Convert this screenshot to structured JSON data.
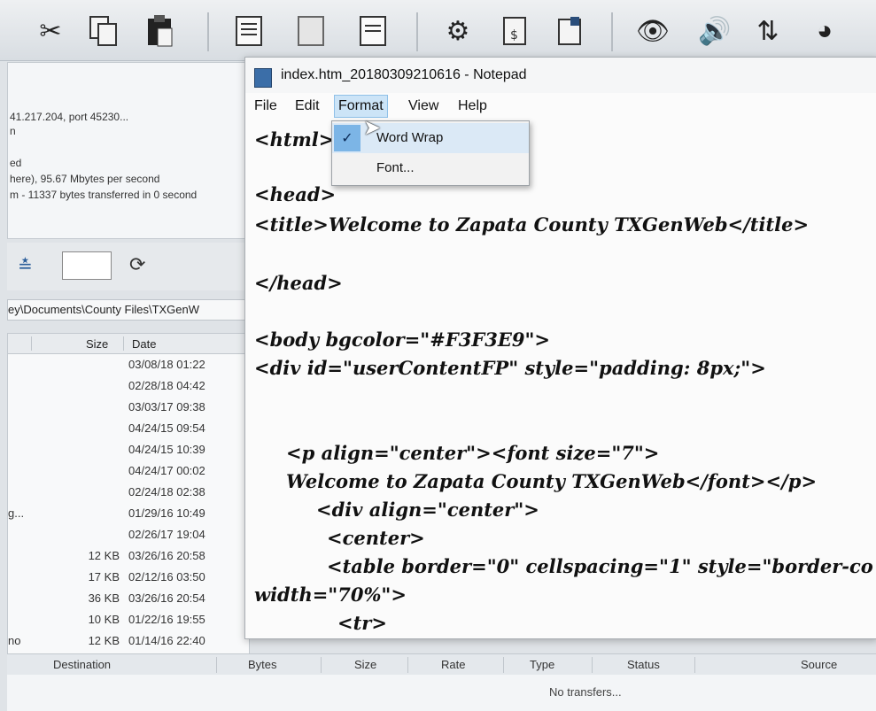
{
  "notepad": {
    "title": "index.htm_20180309210616 - Notepad",
    "menu": [
      "File",
      "Edit",
      "Format",
      "View",
      "Help"
    ],
    "format_menu": {
      "word_wrap": "Word Wrap",
      "word_wrap_check": "✓",
      "font": "Font..."
    },
    "lines": [
      "<html>",
      "<head>",
      "<title>Welcome to Zapata County TXGenWeb</title>",
      "</head>",
      "<body bgcolor=\"#F3F3E9\">",
      "<div id=\"userContentFP\" style=\"padding: 8px;\">",
      "<p align=\"center\"><font size=\"7\">",
      "Welcome to Zapata County TXGenWeb</font></p>",
      "<div align=\"center\">",
      "<center>",
      "<table border=\"0\" cellspacing=\"1\" style=\"border-co",
      "width=\"70%\">",
      "<tr>"
    ]
  },
  "ftp": {
    "log": [
      "41.217.204, port 45230...",
      "n",
      "ed",
      "here), 95.67 Mbytes per second",
      "m - 11337 bytes transferred in 0 second"
    ],
    "local_path": "ey\\Documents\\County Files\\TXGenW",
    "file_columns": {
      "size": "Size",
      "date": "Date"
    },
    "files": [
      {
        "name": "",
        "size": "",
        "date": "03/08/18 01:22"
      },
      {
        "name": "",
        "size": "",
        "date": "02/28/18 04:42"
      },
      {
        "name": "",
        "size": "",
        "date": "03/03/17 09:38"
      },
      {
        "name": "",
        "size": "",
        "date": "04/24/15 09:54"
      },
      {
        "name": "",
        "size": "",
        "date": "04/24/15 10:39"
      },
      {
        "name": "",
        "size": "",
        "date": "04/24/17 00:02"
      },
      {
        "name": "",
        "size": "",
        "date": "02/24/18 02:38"
      },
      {
        "name": "g...",
        "size": "",
        "date": "01/29/16 10:49"
      },
      {
        "name": "",
        "size": "",
        "date": "02/26/17 19:04"
      },
      {
        "name": "",
        "size": "12 KB",
        "date": "03/26/16 20:58"
      },
      {
        "name": "",
        "size": "17 KB",
        "date": "02/12/16 03:50"
      },
      {
        "name": "",
        "size": "36 KB",
        "date": "03/26/16 20:54"
      },
      {
        "name": "",
        "size": "10 KB",
        "date": "01/22/16 19:55"
      },
      {
        "name": "no",
        "size": "12 KB",
        "date": "01/14/16 22:40"
      }
    ],
    "transfer_columns": [
      "Destination",
      "Bytes",
      "Size",
      "Rate",
      "Type",
      "Status",
      "Source"
    ],
    "no_transfers": "No transfers..."
  },
  "icons": [
    "scissors-icon",
    "copy-icon",
    "paste-icon",
    "document-icon",
    "settings-icon",
    "calculator-icon",
    "eye-icon",
    "speaker-icon",
    "sort-icon",
    "pie-icon"
  ]
}
